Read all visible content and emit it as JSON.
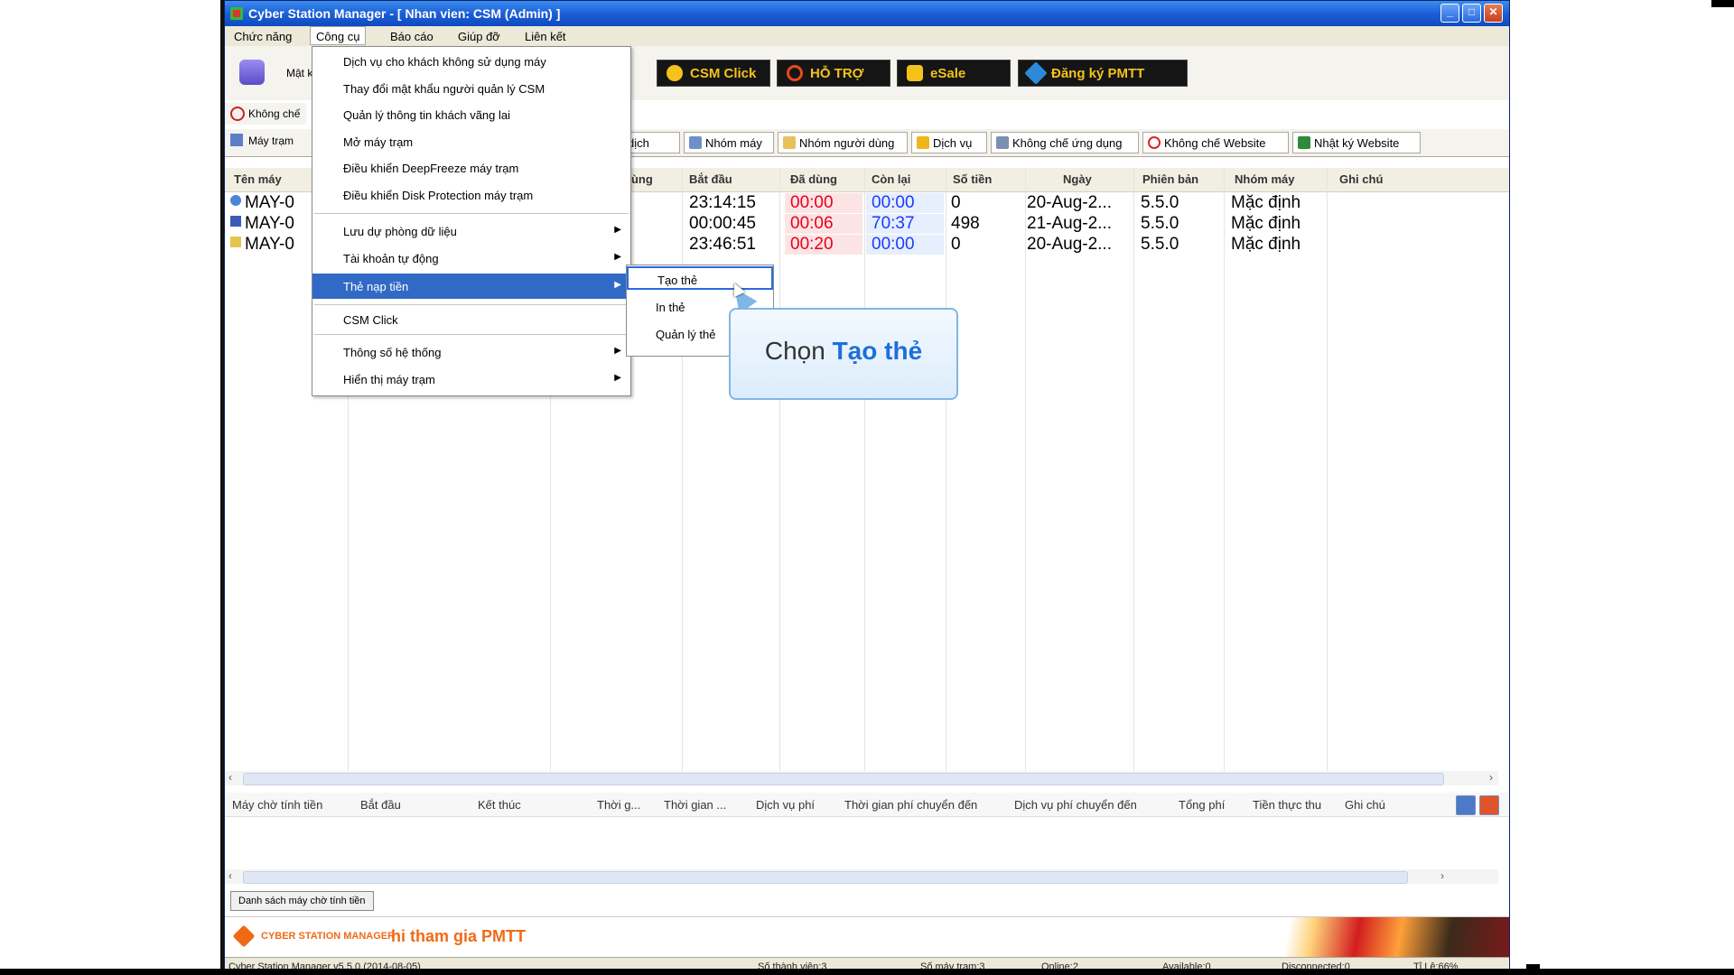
{
  "window": {
    "title": "Cyber Station Manager - [ Nhan vien: CSM (Admin) ]"
  },
  "menubar": {
    "items": [
      "Chức năng",
      "Công cụ",
      "Báo cáo",
      "Giúp đỡ",
      "Liên kết"
    ]
  },
  "toolbar": {
    "label_partial": "Mật k",
    "promos": [
      "CSM Click",
      "HỖ TRỢ",
      "eSale",
      "Đăng ký PMTT"
    ]
  },
  "side": {
    "row1": "Không chế",
    "row2": "Máy trạm"
  },
  "tabs": [
    "dịch",
    "Nhóm máy",
    "Nhóm người dùng",
    "Dịch vụ",
    "Không chế ứng dụng",
    "Không chế Website",
    "Nhật ký Website"
  ],
  "grid": {
    "headers": [
      "Tên máy",
      "dùng",
      "Bắt đầu",
      "Đã dùng",
      "Còn lại",
      "Số tiền",
      "Ngày",
      "Phiên bản",
      "Nhóm máy",
      "Ghi chú"
    ],
    "rows": [
      {
        "name": "MAY-0",
        "start": "23:14:15",
        "used": "00:00",
        "left": "00:00",
        "money": "0",
        "date": "20-Aug-2...",
        "version": "5.5.0",
        "group": "Mặc định"
      },
      {
        "name": "MAY-0",
        "start": "00:00:45",
        "used": "00:06",
        "left": "70:37",
        "money": "498",
        "date": "21-Aug-2...",
        "version": "5.5.0",
        "group": "Mặc định"
      },
      {
        "name": "MAY-0",
        "start": "23:46:51",
        "used": "00:20",
        "left": "00:00",
        "money": "0",
        "date": "20-Aug-2...",
        "version": "5.5.0",
        "group": "Mặc định"
      }
    ]
  },
  "dropdown": {
    "items": [
      "Dịch vụ cho khách không sử dụng máy",
      "Thay đổi mật khẩu người quản lý CSM",
      "Quản lý thông tin khách vãng lai",
      "Mở máy trạm",
      "Điều khiển DeepFreeze máy trạm",
      "Điều khiển Disk Protection máy trạm",
      "Lưu dự phòng dữ liệu",
      "Tài khoản tự động",
      "Thẻ nạp tiền",
      "CSM Click",
      "Thông số hệ thống",
      "Hiển thị máy trạm"
    ]
  },
  "submenu": {
    "items": [
      "Tạo thẻ",
      "In thẻ",
      "Quản lý thẻ"
    ]
  },
  "callout": {
    "prefix": "Chọn",
    "highlight": "Tạo thẻ"
  },
  "subgrid": {
    "headers": [
      "Máy chờ tính tiền",
      "Bắt đầu",
      "Kết thúc",
      "Thời g...",
      "Thời gian ...",
      "Dịch vụ phí",
      "Thời gian phí chuyển đến",
      "Dịch vụ phí chuyển đến",
      "Tổng phí",
      "Tiền thực thu",
      "Ghi chú"
    ]
  },
  "list_button": "Danh sách máy chờ tính tiền",
  "banner": {
    "brand": "CYBER STATION MANAGER",
    "cta": "hi tham gia PMTT"
  },
  "status": {
    "version": "Cyber Station Manager v5.5.0 (2014-08-05)",
    "members": "Số thành viên:3",
    "stations": "Số máy trạm:3",
    "online": "Online:2",
    "available": "Available:0",
    "disconnected": "Disconnected:0",
    "ratio": "Tỉ Lệ:66%"
  }
}
